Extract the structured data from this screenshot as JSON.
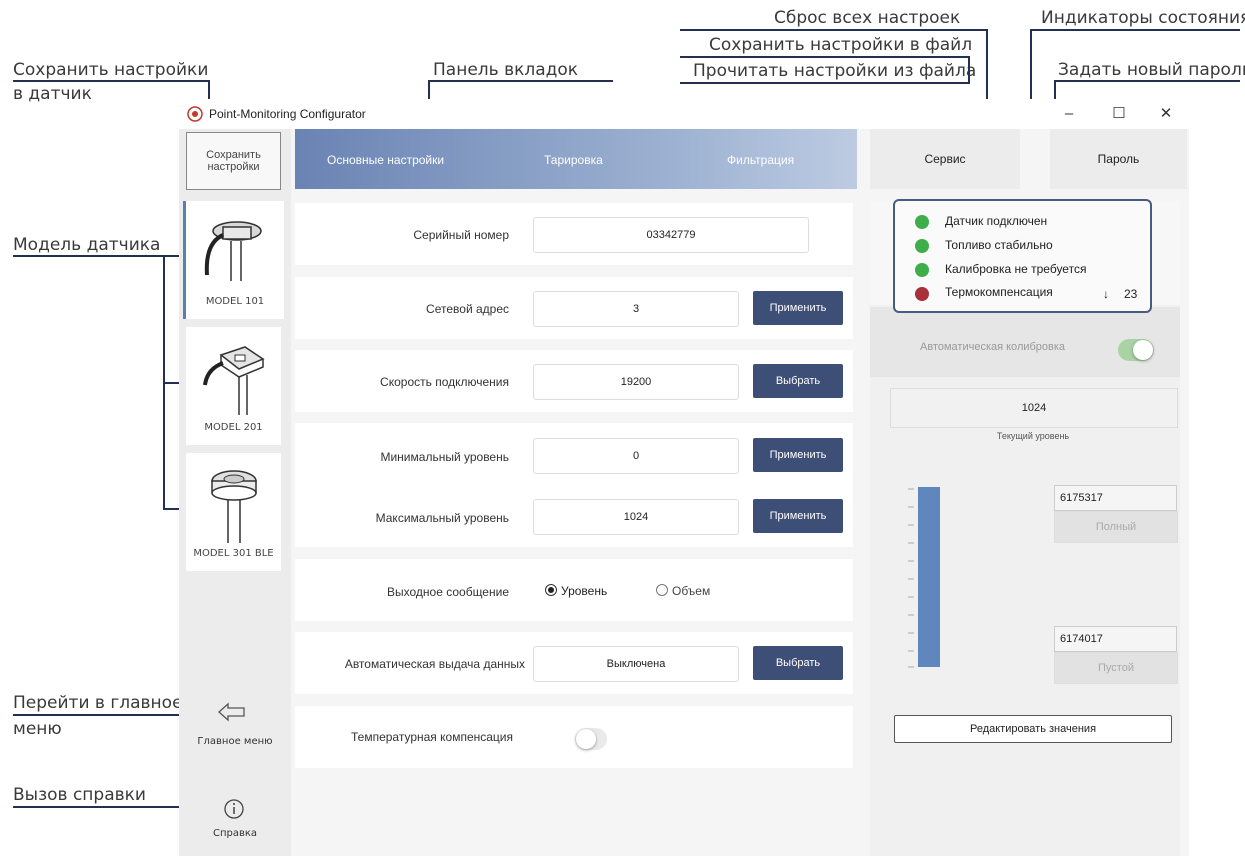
{
  "annotations": {
    "save_to_sensor_line1": "Сохранить настройки",
    "save_to_sensor_line2": "в датчик",
    "tab_panel": "Панель вкладок",
    "reset_all": "Сброс всех настроек",
    "save_to_file": "Сохранить настройки в файл",
    "read_from_file": "Прочитать настройки из файла",
    "status_indicators": "Индикаторы состояния",
    "set_password": "Задать новый пароль",
    "sensor_model": "Модель датчика",
    "main_menu_line1": "Перейти в главное",
    "main_menu_line2": "меню",
    "help": "Вызов справки"
  },
  "window": {
    "title": "Point-Monitoring Configurator",
    "minimize": "–",
    "maximize": "☐",
    "close": "✕"
  },
  "sidebar": {
    "save_button": "Сохранить настройки",
    "models": [
      {
        "label": "MODEL 101",
        "active": true
      },
      {
        "label": "MODEL 201",
        "active": false
      },
      {
        "label": "MODEL 301 BLE",
        "active": false
      }
    ],
    "main_menu_label": "Главное меню",
    "help_label": "Справка"
  },
  "tabs": [
    "Основные настройки",
    "Тарировка",
    "Фильтрация"
  ],
  "right_tabs": [
    "Сервис",
    "Пароль"
  ],
  "settings": {
    "serial_label": "Серийный номер",
    "serial_value": "03342779",
    "address_label": "Сетевой адрес",
    "address_value": "3",
    "address_button": "Применить",
    "speed_label": "Скорость подключения",
    "speed_value": "19200",
    "speed_button": "Выбрать",
    "min_label": "Минимальный уровень",
    "min_value": "0",
    "min_button": "Применить",
    "max_label": "Максимальный уровень",
    "max_value": "1024",
    "max_button": "Применить",
    "output_label": "Выходное сообщение",
    "output_option_level": "Уровень",
    "output_option_volume": "Объем",
    "output_selected": "Уровень",
    "auto_label": "Автоматическая выдача данных",
    "auto_value": "Выключена",
    "auto_button": "Выбрать",
    "temp_label": "Температурная компенсация",
    "temp_enabled": false
  },
  "status": {
    "items": [
      {
        "text": "Датчик подключен",
        "color": "#3fae49"
      },
      {
        "text": "Топливо стабильно",
        "color": "#3fae49"
      },
      {
        "text": "Калибровка не требуется",
        "color": "#3fae49"
      },
      {
        "text": "Термокомпенсация",
        "color": "#a8303a"
      }
    ],
    "temp_arrow": "↓",
    "temp_value": "23"
  },
  "service": {
    "auto_calibration_label": "Автоматическая колибровка",
    "auto_calibration_enabled": true,
    "current_level_value": "1024",
    "current_level_label": "Текущий уровень",
    "full_value": "6175317",
    "full_button": "Полный",
    "empty_value": "6174017",
    "empty_button": "Пустой",
    "edit_button": "Редактировать значения",
    "level_fill_fraction": 1.0
  },
  "colors": {
    "accent": "#3d4e77",
    "tab_gradient_start": "#6a83b3",
    "level_bar": "#5f86bd",
    "ok": "#3fae49",
    "alert": "#a8303a"
  }
}
